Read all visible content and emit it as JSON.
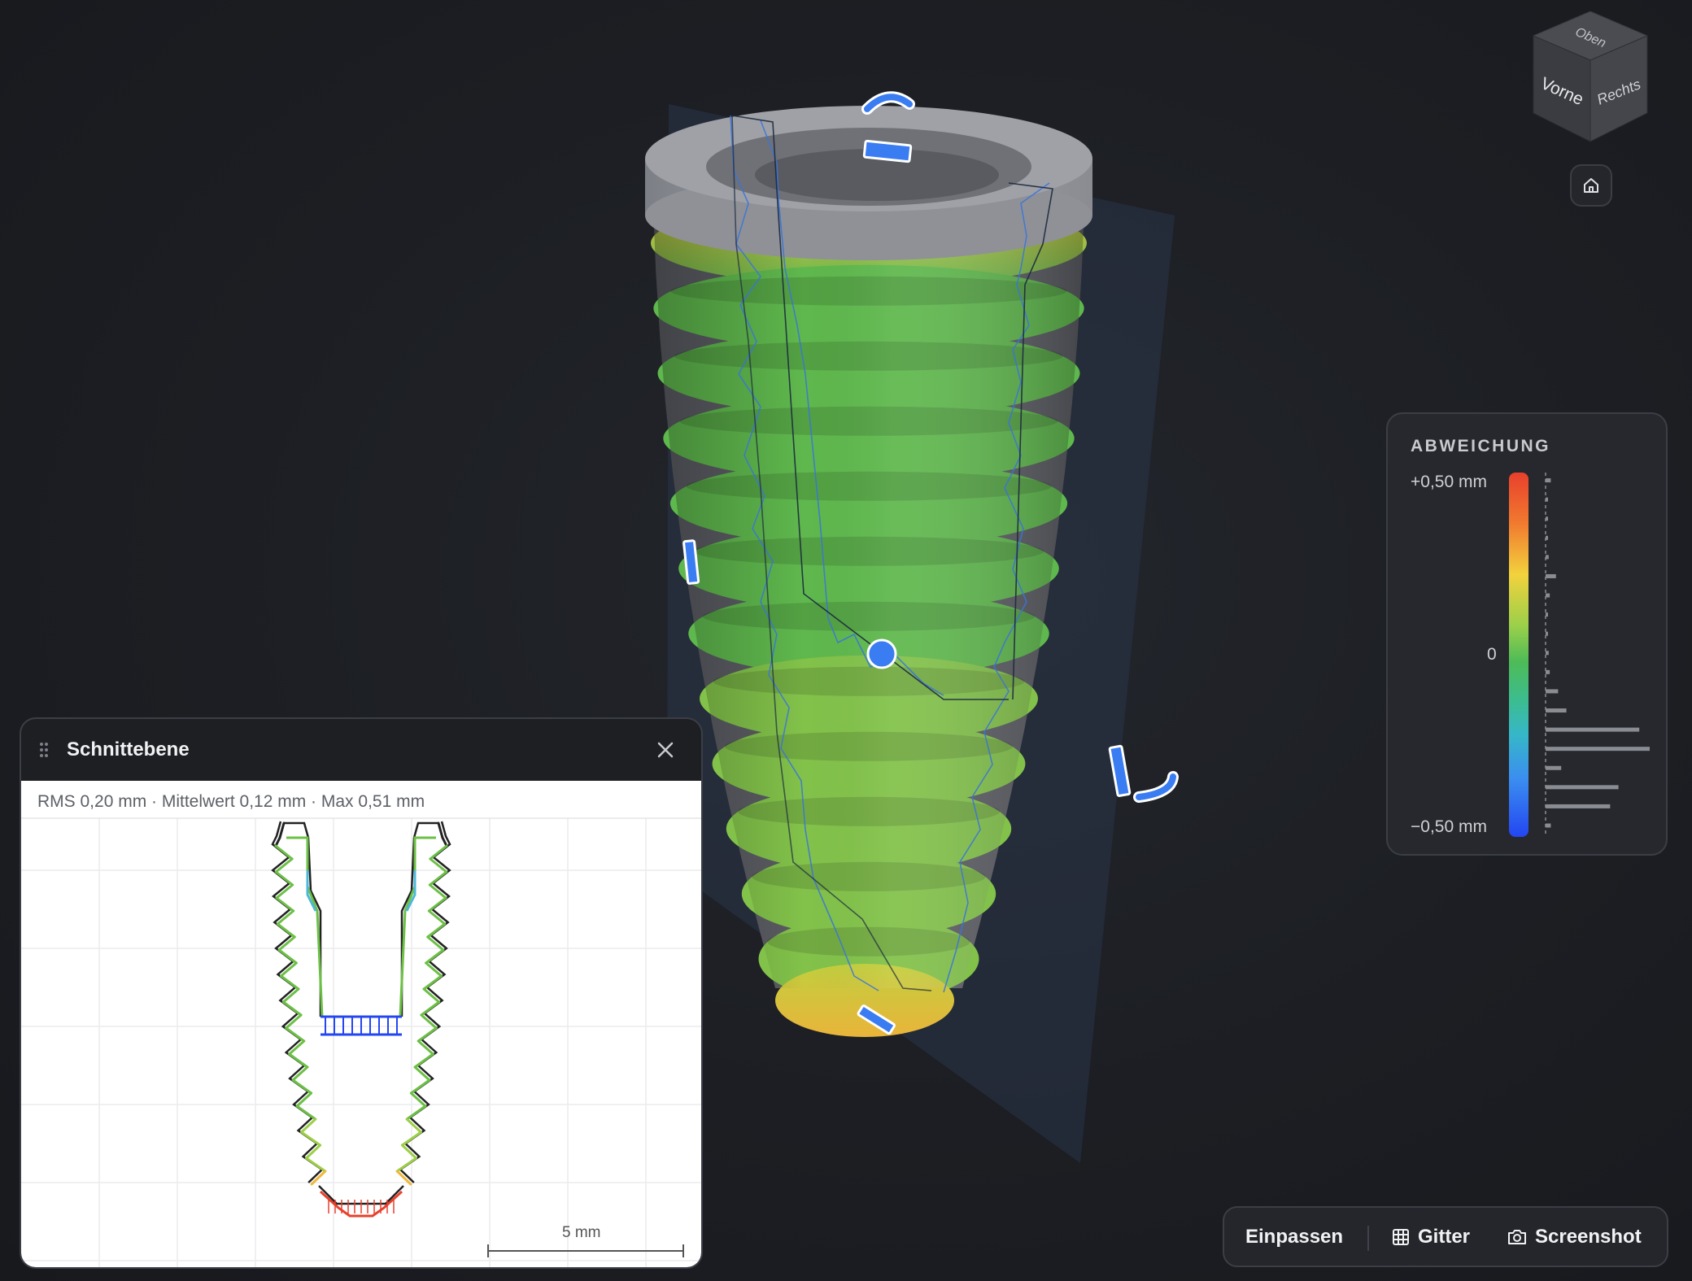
{
  "viewcube": {
    "top": "Oben",
    "front": "Vorne",
    "right": "Rechts"
  },
  "legend": {
    "title": "ABWEICHUNG",
    "max_label": "+0,50 mm",
    "zero_label": "0",
    "min_label": "−0,50 mm",
    "histogram": [
      0.05,
      0.02,
      0.02,
      0.02,
      0.03,
      0.1,
      0.04,
      0.02,
      0.02,
      0.03,
      0.04,
      0.12,
      0.2,
      0.9,
      1.0,
      0.15,
      0.7,
      0.62,
      0.05
    ]
  },
  "section_panel": {
    "title": "Schnittebene",
    "stats": "RMS 0,20 mm · Mittelwert 0,12 mm · Max 0,51 mm",
    "scale_label": "5 mm"
  },
  "toolbar": {
    "fit_label": "Einpassen",
    "grid_label": "Gitter",
    "screenshot_label": "Screenshot"
  },
  "colors": {
    "accent": "#3a7cf2",
    "deviation_green": "#5fb84d",
    "deviation_yellow": "#e8c33a",
    "deviation_red": "#e8402c",
    "neutral_gray": "#8a8c93"
  }
}
